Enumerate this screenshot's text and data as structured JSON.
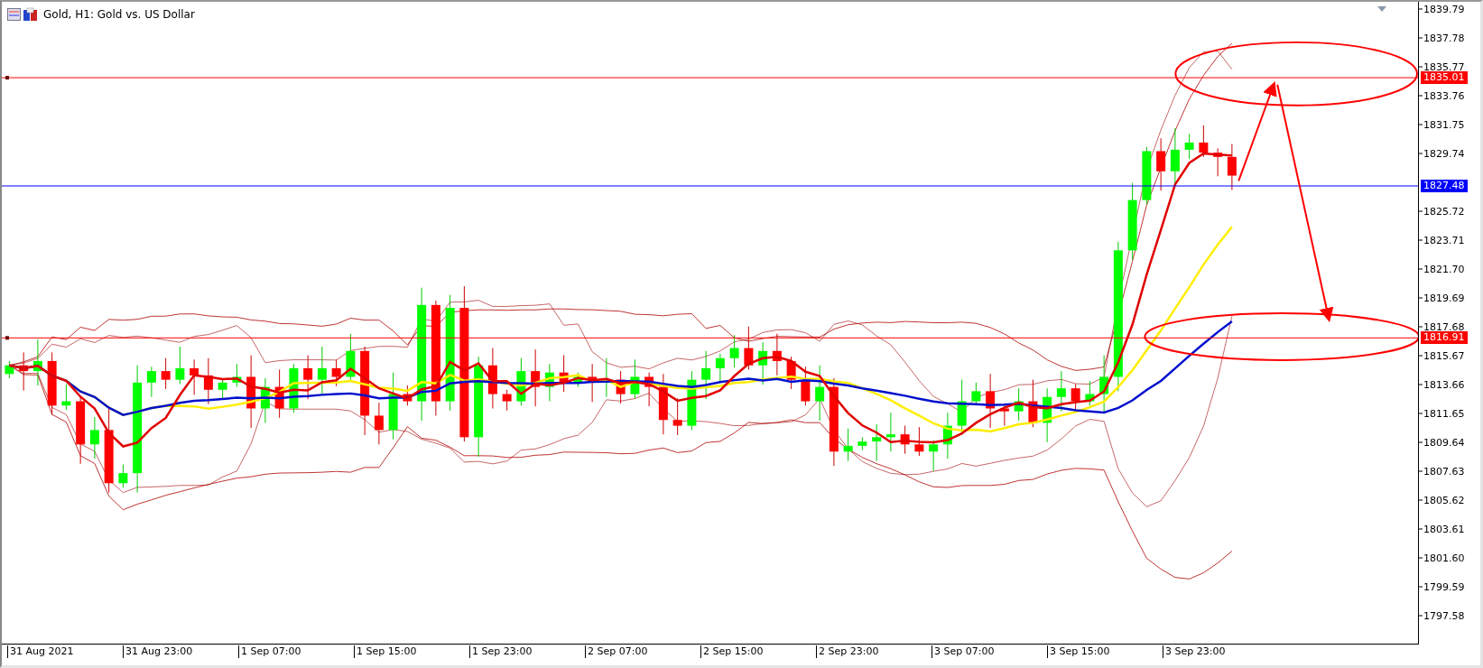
{
  "chart": {
    "title": "Gold, H1:  Gold vs. US Dollar",
    "price_axis": [
      "1839.79",
      "1837.78",
      "1835.77",
      "1833.76",
      "1831.75",
      "1829.74",
      "1825.72",
      "1823.71",
      "1821.70",
      "1819.69",
      "1817.68",
      "1815.67",
      "1813.66",
      "1811.65",
      "1809.64",
      "1807.63",
      "1805.62",
      "1803.61",
      "1801.60",
      "1799.59",
      "1797.58"
    ],
    "price_lines": [
      {
        "price": "1835.01",
        "color": "#ff0000"
      },
      {
        "price": "1827.48",
        "color": "#0000ff"
      },
      {
        "price": "1816.91",
        "color": "#ff0000"
      }
    ],
    "time_axis": [
      "31 Aug 2021",
      "31 Aug 23:00",
      "1 Sep 07:00",
      "1 Sep 15:00",
      "1 Sep 23:00",
      "2 Sep 07:00",
      "2 Sep 15:00",
      "2 Sep 23:00",
      "3 Sep 07:00",
      "3 Sep 15:00",
      "3 Sep 23:00"
    ]
  }
}
